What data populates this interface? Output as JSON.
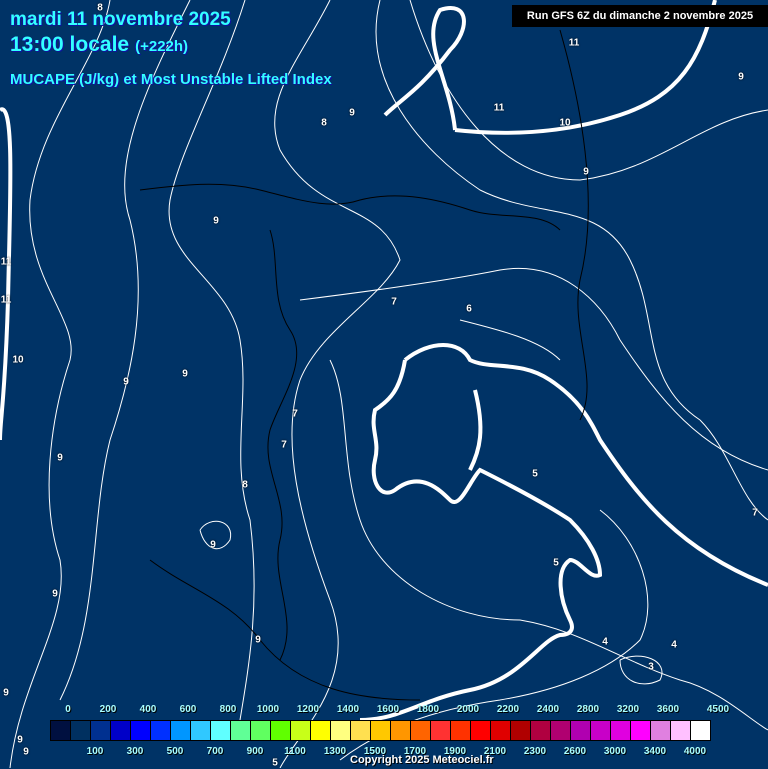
{
  "header": {
    "date": "mardi 11 novembre 2025",
    "time": "13:00 locale",
    "lead": "(+222h)",
    "title": "MUCAPE (J/kg) et Most Unstable Lifted Index",
    "run": "Run GFS 6Z du dimanche 2 novembre 2025"
  },
  "contour_labels": [
    "8",
    "11",
    "9",
    "11",
    "10",
    "9",
    "8",
    "9",
    "9",
    "11",
    "11",
    "7",
    "6",
    "10",
    "9",
    "9",
    "7",
    "7",
    "9",
    "5",
    "8",
    "7",
    "9",
    "5",
    "9",
    "9",
    "4",
    "4",
    "3",
    "9",
    "9",
    "9",
    "5"
  ],
  "legend": {
    "colors": [
      "#001040",
      "#003060",
      "#003090",
      "#0000c8",
      "#0000ff",
      "#0030ff",
      "#0096ff",
      "#30c8ff",
      "#60ffff",
      "#60ff96",
      "#60ff60",
      "#60ff00",
      "#c8ff18",
      "#ffff00",
      "#ffff80",
      "#ffe050",
      "#ffc800",
      "#ff9600",
      "#ff6400",
      "#ff3232",
      "#ff3200",
      "#ff0000",
      "#e00000",
      "#b00000",
      "#b00040",
      "#b00070",
      "#b000b0",
      "#c800c8",
      "#e000e0",
      "#ff00ff",
      "#e080e0",
      "#ffc0ff",
      "#ffffff"
    ],
    "top_labels": [
      "0",
      "200",
      "400",
      "600",
      "800",
      "1000",
      "1200",
      "1400",
      "1600",
      "1800",
      "2000",
      "2200",
      "2400",
      "2800",
      "3200",
      "3600",
      "4500"
    ],
    "bottom_labels": [
      "100",
      "300",
      "500",
      "700",
      "900",
      "1100",
      "1300",
      "1500",
      "1700",
      "1900",
      "2100",
      "2300",
      "2600",
      "3000",
      "3400",
      "4000"
    ]
  },
  "copyright": "Copyright 2025 Meteociel.fr"
}
